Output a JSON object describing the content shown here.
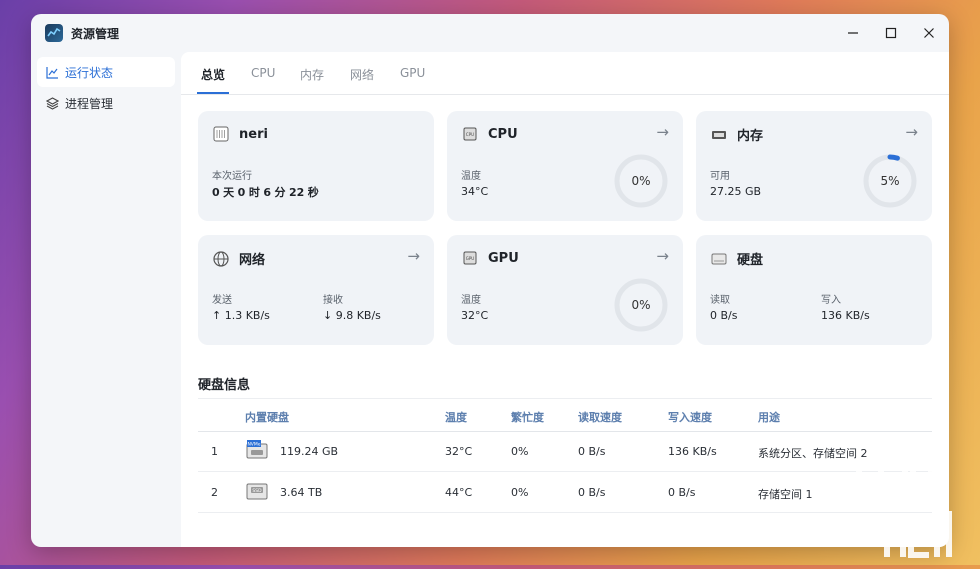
{
  "window": {
    "title": "资源管理"
  },
  "sidebar": {
    "items": [
      {
        "label": "运行状态",
        "icon": "chart-line-icon",
        "active": true
      },
      {
        "label": "进程管理",
        "icon": "layers-icon",
        "active": false
      }
    ]
  },
  "tabs": [
    {
      "label": "总览",
      "active": true
    },
    {
      "label": "CPU"
    },
    {
      "label": "内存"
    },
    {
      "label": "网络"
    },
    {
      "label": "GPU"
    }
  ],
  "cards": {
    "host": {
      "title": "neri",
      "icon": "computer-chip-icon",
      "label": "本次运行",
      "uptime": {
        "d": "0",
        "d_unit": "天",
        "h": "0",
        "h_unit": "时",
        "m": "6",
        "m_unit": "分",
        "s": "22",
        "s_unit": "秒"
      }
    },
    "cpu": {
      "title": "CPU",
      "icon": "cpu-icon",
      "label": "温度",
      "value": "34°C",
      "percent_text": "0%",
      "percent": 0
    },
    "memory": {
      "title": "内存",
      "icon": "ram-icon",
      "label": "可用",
      "value": "27.25 GB",
      "percent_text": "5%",
      "percent": 5
    },
    "network": {
      "title": "网络",
      "icon": "network-icon",
      "send_label": "发送",
      "send_value": "↑ 1.3 KB/s",
      "recv_label": "接收",
      "recv_value": "↓ 9.8 KB/s"
    },
    "gpu": {
      "title": "GPU",
      "icon": "gpu-icon",
      "label": "温度",
      "value": "32°C",
      "percent_text": "0%",
      "percent": 0
    },
    "disk": {
      "title": "硬盘",
      "icon": "disk-icon",
      "read_label": "读取",
      "read_value": "0 B/s",
      "write_label": "写入",
      "write_value": "136 KB/s"
    }
  },
  "disk_info": {
    "title": "硬盘信息",
    "headers": [
      "内置硬盘",
      "温度",
      "繁忙度",
      "读取速度",
      "写入速度",
      "用途"
    ],
    "rows": [
      {
        "index": "1",
        "icon": "nvme-ssd-icon",
        "icon_text": "NVMe",
        "size": "119.24 GB",
        "temp": "32°C",
        "busy": "0%",
        "read": "0 B/s",
        "write": "136 KB/s",
        "usage": "系统分区、存储空间 2"
      },
      {
        "index": "2",
        "icon": "ssd-icon",
        "icon_text": "SSD",
        "size": "3.64 TB",
        "temp": "44°C",
        "busy": "0%",
        "read": "0 B/s",
        "write": "0 B/s",
        "usage": "存储空间 1"
      }
    ]
  },
  "colors": {
    "accent": "#2b6fd6",
    "ring_track": "#e1e5ea"
  },
  "watermark": {
    "text": "www.chiphell.com"
  }
}
